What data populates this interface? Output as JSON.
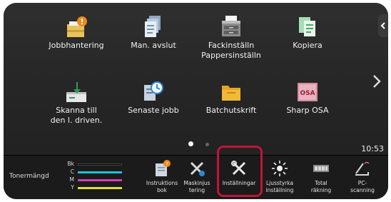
{
  "apps": [
    {
      "label": "Jobbhantering",
      "icon": "job-status-icon"
    },
    {
      "label": "Man. avslut",
      "icon": "document-stack-icon"
    },
    {
      "label": "Fackinställn\nPappersinställn",
      "icon": "paper-tray-icon"
    },
    {
      "label": "Kopiera",
      "icon": "copy-icon"
    },
    {
      "label": "Skanna till\nden l. driven.",
      "icon": "scan-to-drive-icon"
    },
    {
      "label": "Senaste jobb",
      "icon": "recent-jobs-icon"
    },
    {
      "label": "Batchutskrift",
      "icon": "batch-print-folder-icon"
    },
    {
      "label": "Sharp OSA",
      "icon": "sharp-osa-icon"
    }
  ],
  "osa_badge": "OSA",
  "clock": "10:53",
  "toner": {
    "label": "Tonermängd",
    "rows": [
      {
        "key": "Bk",
        "color": "#000000"
      },
      {
        "key": "C",
        "color": "#19c3d8"
      },
      {
        "key": "M",
        "color": "#d83cb4"
      },
      {
        "key": "Y",
        "color": "#e3df2a"
      }
    ]
  },
  "shortcuts": [
    {
      "label": "Instruktions\nbok",
      "icon": "manual-book-icon"
    },
    {
      "label": "Maskinjus\ntering",
      "icon": "machine-adjust-icon"
    },
    {
      "label": "Inställningar",
      "icon": "settings-wrench-icon"
    },
    {
      "label": "Ljusstyrka\ninställning",
      "icon": "brightness-icon"
    },
    {
      "label": "Total\nräkning",
      "icon": "total-count-icon"
    },
    {
      "label": "PC-\nscanning",
      "icon": "pc-scanning-icon"
    }
  ],
  "colors": {
    "highlight": "#c0153a",
    "page_dot_active": "#ffffff",
    "page_dot_inactive": "#666666"
  }
}
